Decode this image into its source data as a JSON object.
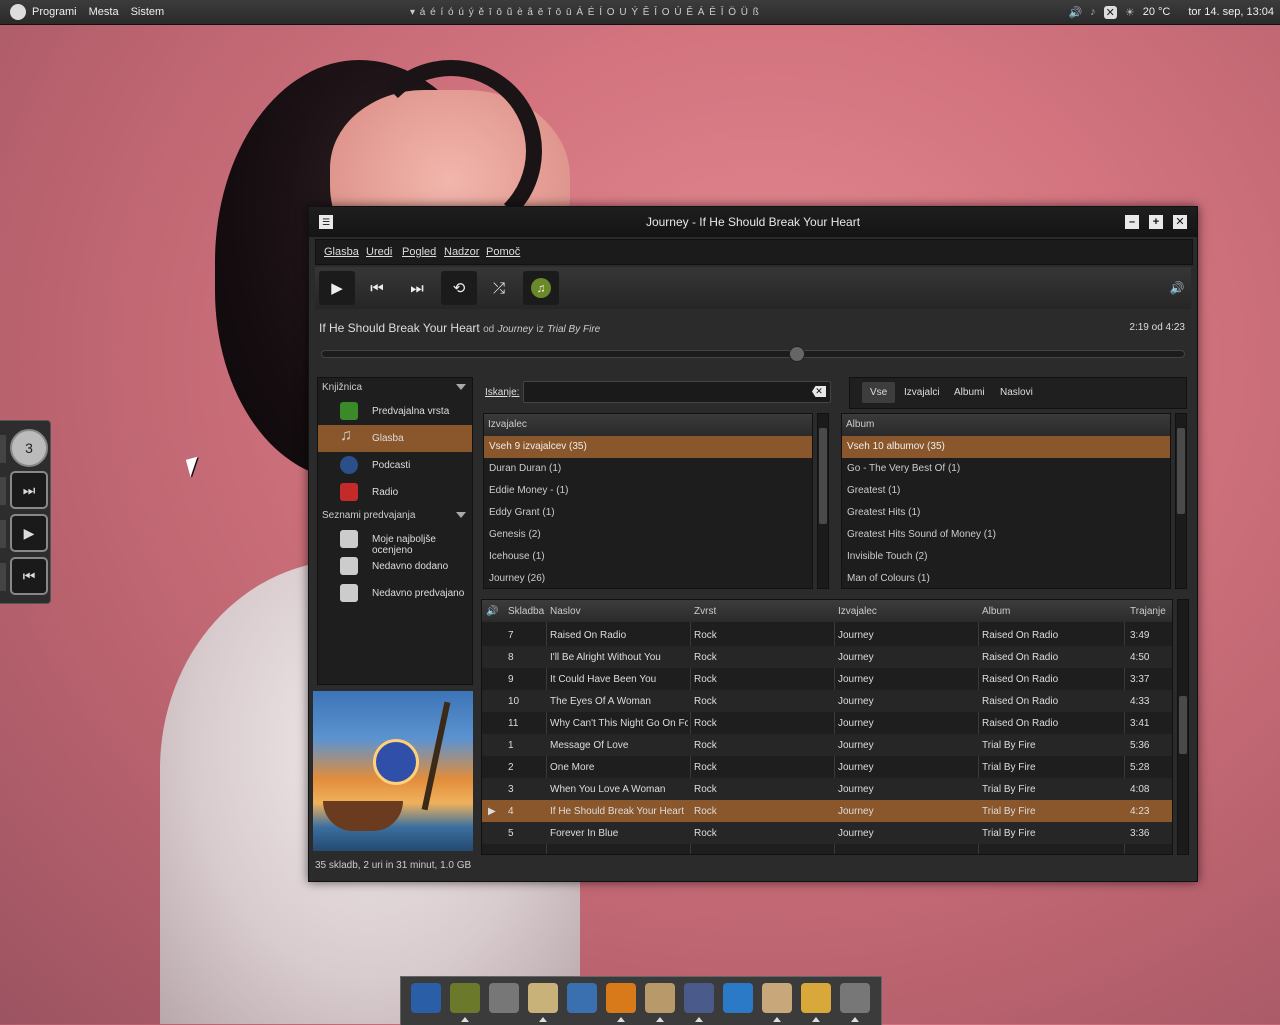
{
  "top_panel": {
    "menus": [
      "Programi",
      "Mesta",
      "Sistem"
    ],
    "special_chars": "▾ á é í ó ú ý ě ī ō ũ è â ē ĩ ō ū Á É Í O U Ý Ě Ī O Ú Ě Á Ē Ī Ö Ü ß",
    "weather": "20 °C",
    "clock": "tor 14. sep, 13:04"
  },
  "window": {
    "title": "Journey - If He Should Break Your Heart",
    "menu": [
      "Glasba",
      "Uredi",
      "Pogled",
      "Nadzor",
      "Pomoč"
    ]
  },
  "now_playing": {
    "title": "If He Should Break Your Heart",
    "by": "od",
    "artist": "Journey",
    "from": "iz",
    "album": "Trial By Fire",
    "time": "2:19 od 4:23",
    "progress": 0.55
  },
  "library": {
    "header": "Knjižnica",
    "items": [
      {
        "label": "Predvajalna vrsta",
        "icon": "queue-icon",
        "color": "#3a8a2a"
      },
      {
        "label": "Glasba",
        "icon": "music-note-icon",
        "color": "#8a562b"
      },
      {
        "label": "Podcasti",
        "icon": "podcast-icon",
        "color": "#2a4f8a"
      },
      {
        "label": "Radio",
        "icon": "radio-icon",
        "color": "#c42a2a"
      }
    ],
    "playlists_header": "Seznami predvajanja",
    "playlists": [
      "Moje najboljše ocenjeno",
      "Nedavno dodano",
      "Nedavno predvajano"
    ]
  },
  "search": {
    "label": "Iskanje:",
    "value": ""
  },
  "filters": [
    "Vse",
    "Izvajalci",
    "Albumi",
    "Naslovi"
  ],
  "artist_browser": {
    "header": "Izvajalec",
    "rows": [
      "Vseh 9 izvajalcev (35)",
      "Duran Duran (1)",
      "Eddie Money - (1)",
      "Eddy Grant (1)",
      "Genesis (2)",
      "Icehouse (1)",
      "Journey (26)"
    ]
  },
  "album_browser": {
    "header": "Album",
    "rows": [
      "Vseh 10 albumov (35)",
      "Go - The Very Best Of (1)",
      "Greatest (1)",
      "Greatest Hits (1)",
      "Greatest Hits Sound of Money (1)",
      "Invisible Touch (2)",
      "Man of Colours (1)"
    ]
  },
  "tracks": {
    "columns": [
      "Skladba",
      "Naslov",
      "Zvrst",
      "Izvajalec",
      "Album",
      "Trajanje"
    ],
    "rows": [
      [
        "7",
        "Raised On Radio",
        "Rock",
        "Journey",
        "Raised On Radio",
        "3:49"
      ],
      [
        "8",
        "I'll Be Alright Without You",
        "Rock",
        "Journey",
        "Raised On Radio",
        "4:50"
      ],
      [
        "9",
        "It Could Have Been You",
        "Rock",
        "Journey",
        "Raised On Radio",
        "3:37"
      ],
      [
        "10",
        "The Eyes Of A Woman",
        "Rock",
        "Journey",
        "Raised On Radio",
        "4:33"
      ],
      [
        "11",
        "Why Can't This Night Go On For...",
        "Rock",
        "Journey",
        "Raised On Radio",
        "3:41"
      ],
      [
        "1",
        "Message Of Love",
        "Rock",
        "Journey",
        "Trial By Fire",
        "5:36"
      ],
      [
        "2",
        "One More",
        "Rock",
        "Journey",
        "Trial By Fire",
        "5:28"
      ],
      [
        "3",
        "When You Love A Woman",
        "Rock",
        "Journey",
        "Trial By Fire",
        "4:08"
      ],
      [
        "4",
        "If He Should Break Your Heart",
        "Rock",
        "Journey",
        "Trial By Fire",
        "4:23"
      ],
      [
        "5",
        "Forever In Blue",
        "Rock",
        "Journey",
        "Trial By Fire",
        "3:36"
      ]
    ],
    "playing_index": 8
  },
  "status": "35 skladb, 2 uri in 31 minut, 1.0 GB",
  "dock_icons": [
    "system-monitor-icon",
    "terminal-icon",
    "calculator-icon",
    "text-editor-icon",
    "disk-utility-icon",
    "music-player-icon",
    "file-manager-icon",
    "network-icon",
    "water-drop-icon",
    "shell-icon",
    "image-viewer-icon",
    "speaker-icon"
  ]
}
